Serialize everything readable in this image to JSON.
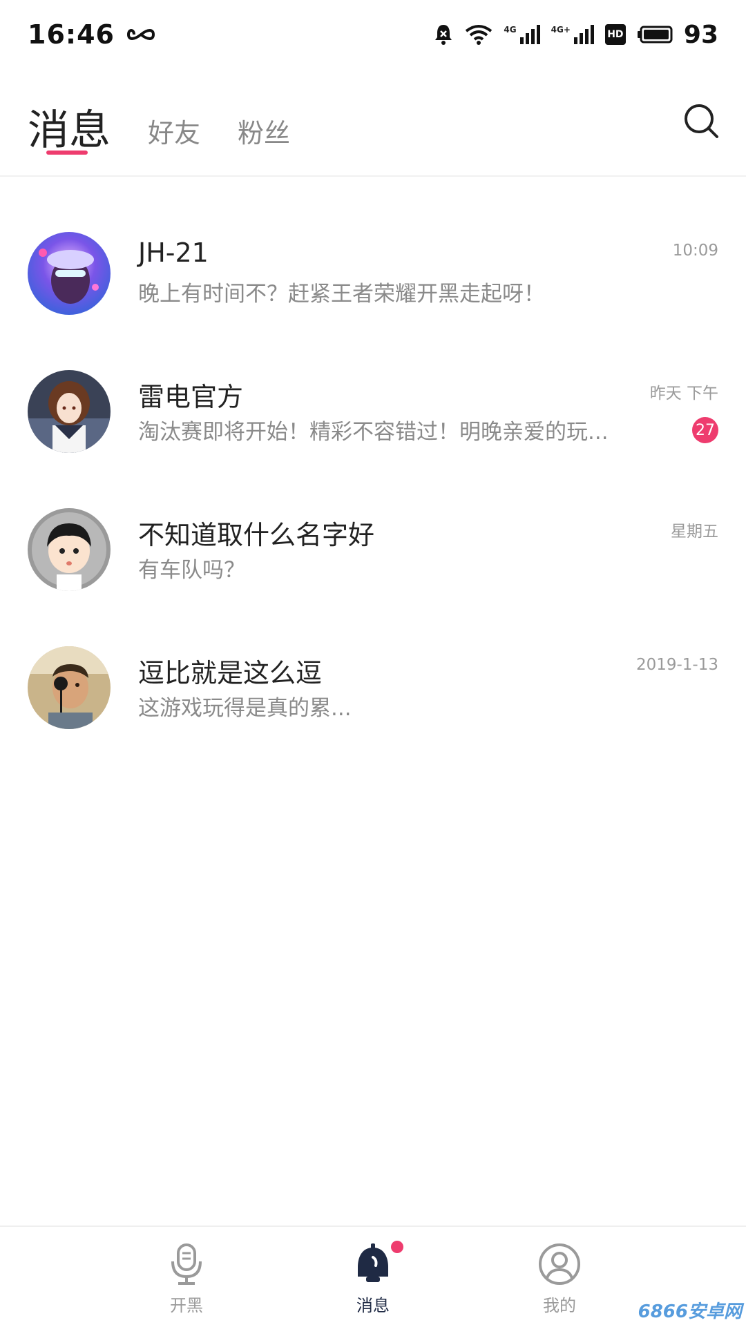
{
  "status_bar": {
    "time": "16:46",
    "battery": "93",
    "network_label_1": "4G",
    "network_label_2": "4G+",
    "hd_label": "HD"
  },
  "tabs": [
    {
      "label": "消息",
      "active": true
    },
    {
      "label": "好友",
      "active": false
    },
    {
      "label": "粉丝",
      "active": false
    }
  ],
  "conversations": [
    {
      "name": "JH-21",
      "preview": "晚上有时间不？赶紧王者荣耀开黑走起呀！",
      "time": "10:09",
      "unread": ""
    },
    {
      "name": "雷电官方",
      "preview": "淘汰赛即将开始！精彩不容错过！明晚亲爱的玩...",
      "time": "昨天 下午",
      "unread": "27"
    },
    {
      "name": "不知道取什么名字好",
      "preview": "有车队吗？",
      "time": "星期五",
      "unread": ""
    },
    {
      "name": "逗比就是这么逗",
      "preview": "这游戏玩得是真的累...",
      "time": "2019-1-13",
      "unread": ""
    }
  ],
  "bottom_nav": [
    {
      "label": "开黑",
      "icon": "microphone-icon",
      "active": false
    },
    {
      "label": "消息",
      "icon": "bell-icon",
      "active": true
    },
    {
      "label": "我的",
      "icon": "user-icon",
      "active": false
    }
  ],
  "watermark": "6866安卓网",
  "colors": {
    "accent": "#ee3c6e",
    "active_nav": "#1f2a44"
  }
}
